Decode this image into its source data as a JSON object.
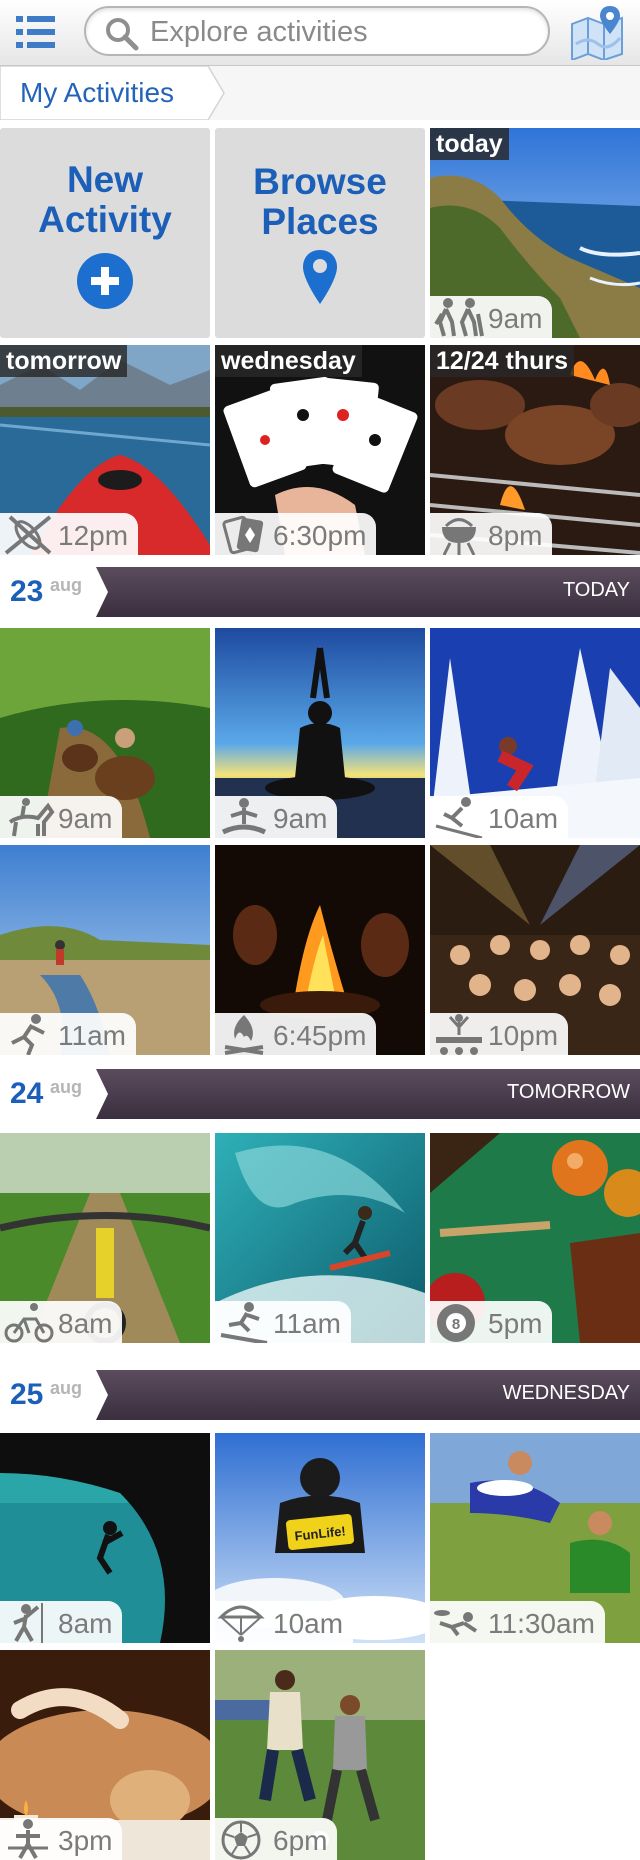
{
  "header": {
    "menu_icon": "list-menu-icon",
    "search_icon": "search-icon",
    "search_placeholder": "Explore activities",
    "map_icon": "map-pin-icon"
  },
  "breadcrumb": {
    "label": "My Activities"
  },
  "actions": {
    "new_activity": {
      "line1": "New",
      "line2": "Activity",
      "icon": "plus-circle-icon"
    },
    "browse_places": {
      "line1": "Browse",
      "line2": "Places",
      "icon": "location-pin-icon"
    }
  },
  "upcoming": [
    {
      "day": "today",
      "time": "9am",
      "icon": "hiking-icon"
    },
    {
      "day": "tomorrow",
      "time": "12pm",
      "icon": "kayak-icon"
    },
    {
      "day": "wednesday",
      "time": "6:30pm",
      "icon": "cards-icon"
    },
    {
      "day": "12/24 thurs",
      "time": "8pm",
      "icon": "grill-icon"
    }
  ],
  "days": [
    {
      "num": "23",
      "month": "aug",
      "label": "TODAY",
      "activities": [
        {
          "time": "9am",
          "icon": "horse-riding-icon"
        },
        {
          "time": "9am",
          "icon": "yoga-icon"
        },
        {
          "time": "10am",
          "icon": "skiing-icon"
        },
        {
          "time": "11am",
          "icon": "running-icon"
        },
        {
          "time": "6:45pm",
          "icon": "campfire-icon"
        },
        {
          "time": "10pm",
          "icon": "concert-icon"
        }
      ]
    },
    {
      "num": "24",
      "month": "aug",
      "label": "TOMORROW",
      "activities": [
        {
          "time": "8am",
          "icon": "cycling-icon"
        },
        {
          "time": "11am",
          "icon": "surfing-icon"
        },
        {
          "time": "5pm",
          "icon": "billiards-icon"
        }
      ]
    },
    {
      "num": "25",
      "month": "aug",
      "label": "WEDNESDAY",
      "activities": [
        {
          "time": "8am",
          "icon": "climbing-icon"
        },
        {
          "time": "10am",
          "icon": "parachute-icon"
        },
        {
          "time": "11:30am",
          "icon": "frisbee-icon"
        },
        {
          "time": "3pm",
          "icon": "massage-icon"
        },
        {
          "time": "6pm",
          "icon": "soccer-ball-icon"
        }
      ]
    }
  ],
  "photo_text": {
    "skydiver_sign": "FunLife!"
  },
  "colors": {
    "accent": "#1c5fb8",
    "header_band": "#4a3d4e"
  }
}
